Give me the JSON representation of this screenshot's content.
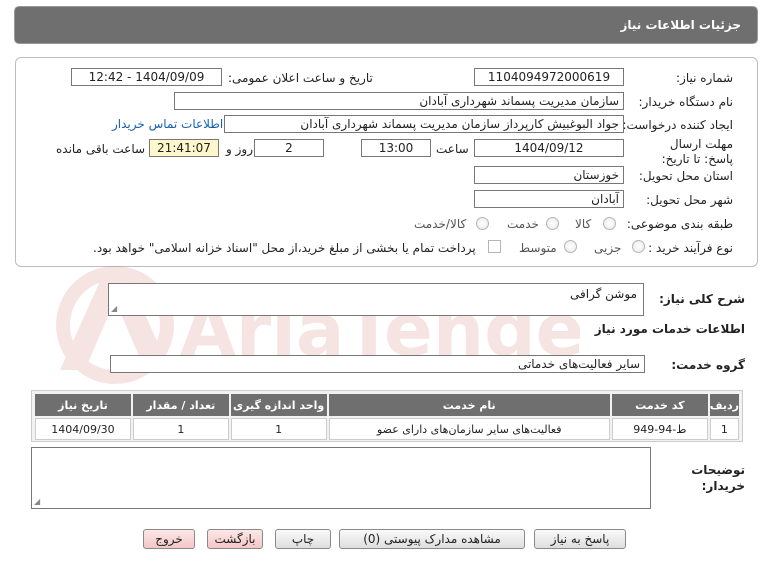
{
  "header": {
    "title": "جزئیات اطلاعات نیاز"
  },
  "form": {
    "need_number_label": "شماره نیاز:",
    "need_number": "1104094972000619",
    "announce_label": "تاریخ و ساعت اعلان عمومی:",
    "announce_value": "1404/09/09 - 12:42",
    "buyer_org_label": "نام دستگاه خریدار:",
    "buyer_org": "سازمان مدیریت پسماند شهرداری آبادان",
    "creator_label": "ایجاد کننده درخواست:",
    "creator": "جواد البوغبیش کارپرداز سازمان مدیریت پسماند شهرداری آبادان",
    "contact_link": "اطلاعات تماس خریدار",
    "deadline_label": "مهلت ارسال پاسخ: تا تاریخ:",
    "deadline_date": "1404/09/12",
    "time_label": "ساعت",
    "deadline_time": "13:00",
    "days_value": "2",
    "days_label": "روز و",
    "remaining_time": "21:41:07",
    "remaining_label": "ساعت باقی مانده",
    "province_label": "استان محل تحویل:",
    "province": "خوزستان",
    "city_label": "شهر محل تحویل:",
    "city": "آبادان",
    "category_label": "طبقه بندی موضوعی:",
    "category_options": [
      "کالا",
      "خدمت",
      "کالا/خدمت"
    ],
    "purchase_label": "نوع فرآیند خرید :",
    "purchase_options": [
      "جزیی",
      "متوسط"
    ],
    "payment_note": "پرداخت تمام یا بخشی از مبلغ خرید،از محل \"اسناد خزانه اسلامی\" خواهد بود."
  },
  "summary": {
    "label": "شرح کلی نیاز:",
    "value": "موشن گرافی",
    "services_title": "اطلاعات خدمات مورد نیاز",
    "group_label": "گروه خدمت:",
    "group_value": "سایر فعالیت‌های خدماتی"
  },
  "table": {
    "headers": [
      "ردیف",
      "کد خدمت",
      "نام خدمت",
      "واحد اندازه گیری",
      "تعداد / مقدار",
      "تاریخ نیاز"
    ],
    "rows": [
      [
        "1",
        "ط-94-949",
        "فعالیت‌های سایر سازمان‌های دارای عضو",
        "1",
        "1",
        "1404/09/30"
      ]
    ]
  },
  "notes": {
    "label": "توضیحات خریدار:"
  },
  "buttons": {
    "reply": "پاسخ به نیاز",
    "attachments": "مشاهده مدارک پیوستی (0)",
    "print": "چاپ",
    "back": "بازگشت",
    "exit": "خروج"
  },
  "watermark": {
    "text": "AriaTender.neT"
  },
  "colors": {
    "header_bg": "#6f6f6f",
    "link": "#1a5fb0",
    "yellow_field": "#fdf7cb",
    "watermark": "#c0392b"
  }
}
